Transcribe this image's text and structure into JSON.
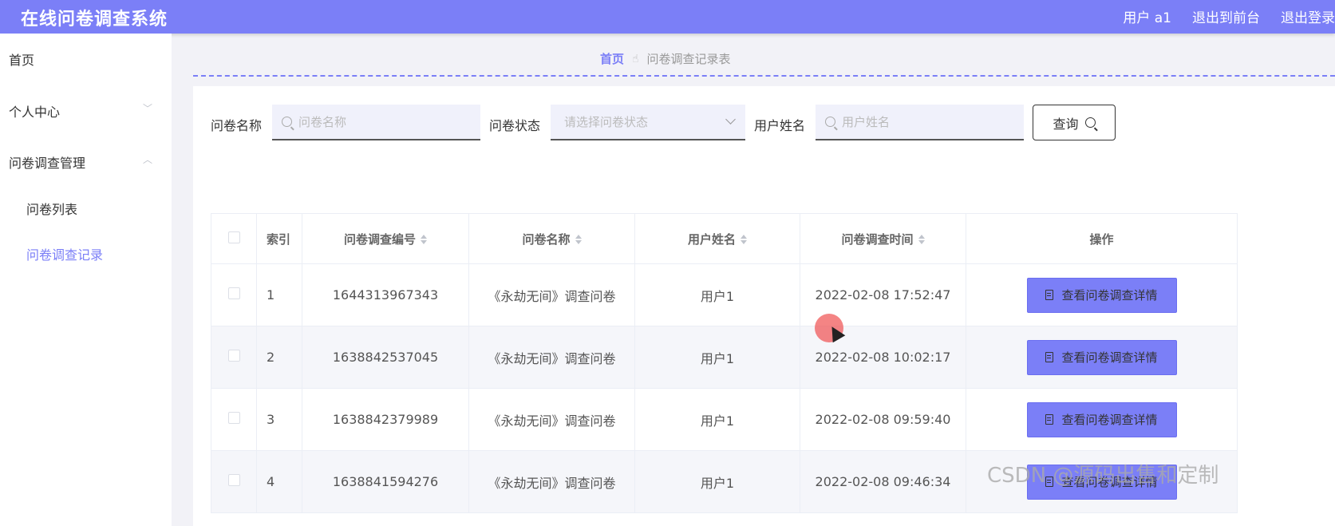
{
  "header": {
    "title": "在线问卷调查系统",
    "user": "用户 a1",
    "to_front": "退出到前台",
    "logout": "退出登录"
  },
  "sidebar": {
    "items": [
      {
        "label": "首页"
      },
      {
        "label": "个人中心"
      },
      {
        "label": "问卷调查管理"
      },
      {
        "label": "问卷列表"
      },
      {
        "label": "问卷调查记录"
      }
    ]
  },
  "breadcrumb": {
    "home": "首页",
    "current": "问卷调查记录表"
  },
  "search": {
    "name_label": "问卷名称",
    "name_placeholder": "问卷名称",
    "status_label": "问卷状态",
    "status_placeholder": "请选择问卷状态",
    "user_label": "用户姓名",
    "user_placeholder": "用户姓名",
    "query_label": "查询"
  },
  "table": {
    "headers": {
      "index": "索引",
      "code": "问卷调查编号",
      "name": "问卷名称",
      "user": "用户姓名",
      "time": "问卷调查时间",
      "action": "操作"
    },
    "rows": [
      {
        "index": "1",
        "code": "1644313967343",
        "name": "《永劫无间》调查问卷",
        "user": "用户1",
        "time": "2022-02-08 17:52:47",
        "action": "查看问卷调查详情"
      },
      {
        "index": "2",
        "code": "1638842537045",
        "name": "《永劫无间》调查问卷",
        "user": "用户1",
        "time": "2022-02-08 10:02:17",
        "action": "查看问卷调查详情"
      },
      {
        "index": "3",
        "code": "1638842379989",
        "name": "《永劫无间》调查问卷",
        "user": "用户1",
        "time": "2022-02-08 09:59:40",
        "action": "查看问卷调查详情"
      },
      {
        "index": "4",
        "code": "1638841594276",
        "name": "《永劫无间》调查问卷",
        "user": "用户1",
        "time": "2022-02-08 09:46:34",
        "action": "查看问卷调查详情"
      }
    ]
  },
  "watermark": "CSDN @源码出售和定制",
  "colors": {
    "accent": "#7b7ff7",
    "background": "#f2f2f7"
  }
}
